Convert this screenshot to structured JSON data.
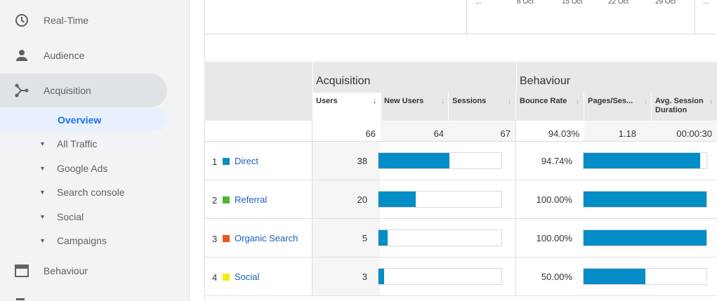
{
  "sidebar": {
    "realtime": "Real-Time",
    "audience": "Audience",
    "acquisition": "Acquisition",
    "overview": "Overview",
    "sub_items": [
      "All Traffic",
      "Google Ads",
      "Search console",
      "Social",
      "Campaigns"
    ],
    "behaviour": "Behaviour"
  },
  "timeline": {
    "ellipsis": "...",
    "dates": [
      "8 Oct",
      "15 Oct",
      "22 Oct",
      "29 Oct"
    ]
  },
  "table": {
    "group_acquisition": "Acquisition",
    "group_behaviour": "Behaviour",
    "columns": [
      "Users",
      "New Users",
      "Sessions",
      "Bounce Rate",
      "Pages/Ses...",
      "Avg. Session Duration"
    ],
    "sort_arrow": "↓",
    "arrow": "↓",
    "totals": {
      "users": "66",
      "new_users": "64",
      "sessions": "67",
      "bounce_rate": "94.03%",
      "pages": "1.18",
      "duration": "00:00:30"
    },
    "rows": [
      {
        "rank": "1",
        "source": "Direct",
        "color": "#058dc7",
        "users": "38",
        "users_pct": 0.576,
        "bounce": "94.74%",
        "bounce_pct": 0.9474
      },
      {
        "rank": "2",
        "source": "Referral",
        "color": "#50b432",
        "users": "20",
        "users_pct": 0.303,
        "bounce": "100.00%",
        "bounce_pct": 1.0
      },
      {
        "rank": "3",
        "source": "Organic Search",
        "color": "#ed561b",
        "users": "5",
        "users_pct": 0.076,
        "bounce": "100.00%",
        "bounce_pct": 1.0
      },
      {
        "rank": "4",
        "source": "Social",
        "color": "#edef00",
        "users": "3",
        "users_pct": 0.045,
        "bounce": "50.00%",
        "bounce_pct": 0.5
      }
    ]
  }
}
